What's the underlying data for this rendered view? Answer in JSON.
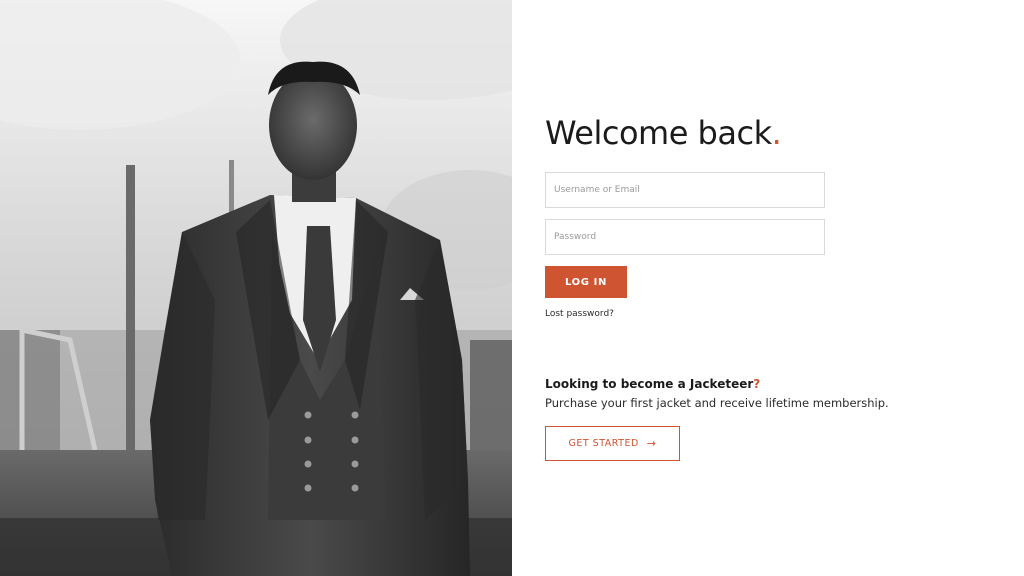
{
  "hero": {
    "alt": "Man in three-piece suit"
  },
  "login": {
    "title_main": "Welcome back",
    "title_dot": ".",
    "username_placeholder": "Username or Email",
    "password_placeholder": "Password",
    "login_button": "LOG IN",
    "lost_password": "Lost password?"
  },
  "signup": {
    "heading_main": "Looking to become a Jacketeer",
    "heading_mark": "?",
    "text": "Purchase your first jacket and receive lifetime membership.",
    "button_label": "GET STARTED",
    "button_icon": "arrow-right-icon",
    "button_arrow": "→"
  },
  "colors": {
    "accent": "#cf5532",
    "text": "#1b1b1b",
    "border": "#d9d9d9"
  }
}
